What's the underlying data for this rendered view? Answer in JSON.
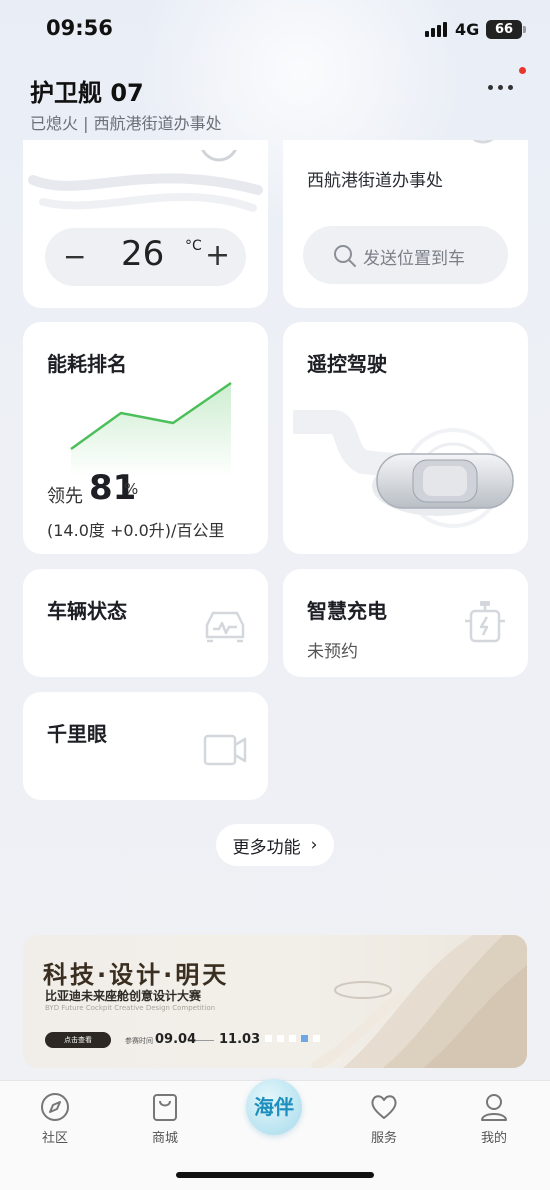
{
  "status_bar": {
    "time": "09:56",
    "network": "4G",
    "battery": "66"
  },
  "header": {
    "title": "护卫舰 07",
    "subtitle": "已熄火 | 西航港街道办事处"
  },
  "climate": {
    "minus": "−",
    "temperature": "26",
    "unit": "°C",
    "plus": "+"
  },
  "location": {
    "address": "西航港街道办事处",
    "send_label": "发送位置到车"
  },
  "energy": {
    "title": "能耗排名",
    "lead_label": "领先",
    "lead_value": "81",
    "lead_unit": "%",
    "detail": "(14.0度 +0.0升)/百公里",
    "chart_color": "#4cbf5a"
  },
  "remote": {
    "title": "遥控驾驶"
  },
  "vehicle_status": {
    "title": "车辆状态",
    "icon": "car-diagnostic-icon"
  },
  "charging": {
    "title": "智慧充电",
    "subtitle": "未预约",
    "icon": "charger-icon"
  },
  "camera": {
    "title": "千里眼",
    "icon": "video-camera-icon"
  },
  "more": {
    "label": "更多功能",
    "chevron": "›"
  },
  "banner": {
    "title": "科技·设计·明天",
    "subtitle": "比亚迪未来座舱创意设计大赛",
    "subtitle_en": "BYD Future Cockpit Creative Design Competition",
    "button": "点击查看",
    "time_label": "参赛时间",
    "date_start": "09.04",
    "date_end": "11.03"
  },
  "tabbar": {
    "items": [
      {
        "label": "社区",
        "icon": "compass-icon"
      },
      {
        "label": "商城",
        "icon": "shopping-bag-icon"
      },
      {
        "label": "海伴",
        "icon": "haiban-logo"
      },
      {
        "label": "服务",
        "icon": "heart-icon"
      },
      {
        "label": "我的",
        "icon": "user-icon"
      }
    ]
  }
}
